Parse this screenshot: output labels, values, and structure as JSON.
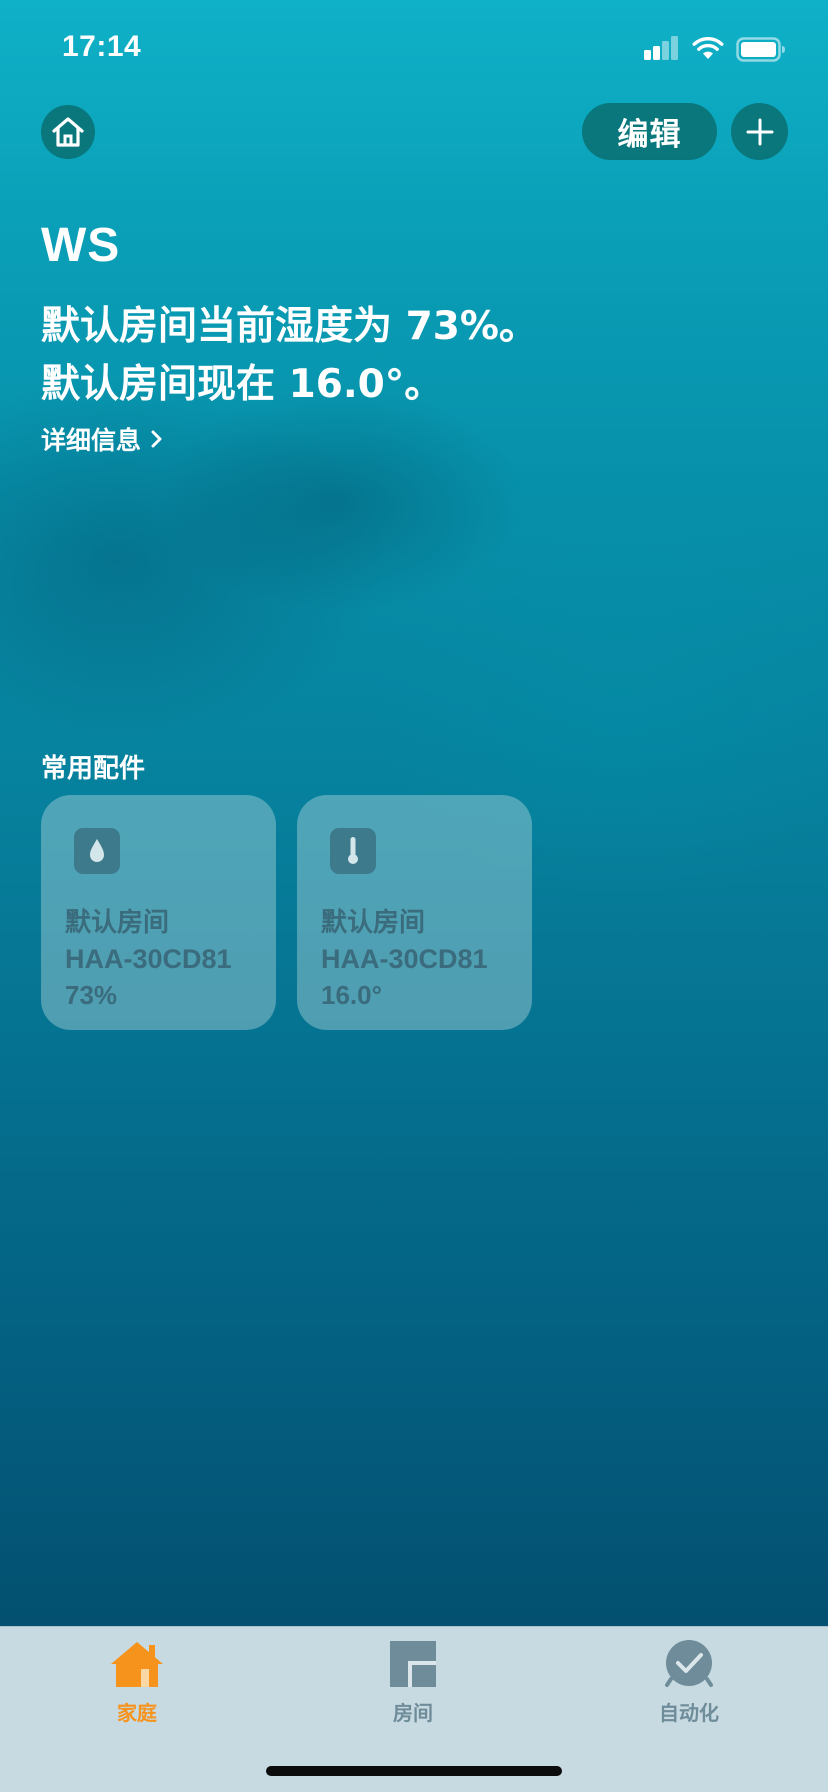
{
  "status_bar": {
    "time": "17:14",
    "signal_icon": "cellular-signal-icon",
    "wifi_icon": "wifi-icon",
    "battery_icon": "battery-icon"
  },
  "header": {
    "home_icon": "house-icon",
    "edit_label": "编辑",
    "add_icon": "plus-icon"
  },
  "summary": {
    "home_name": "WS",
    "line1": "默认房间当前湿度为 73%。",
    "line2": "默认房间现在 16.0°。",
    "details_label": "详细信息"
  },
  "favorites": {
    "title": "常用配件",
    "tiles": [
      {
        "icon": "humidity-drop-icon",
        "room": "默认房间",
        "device": "HAA-30CD81",
        "value": "73%"
      },
      {
        "icon": "thermometer-icon",
        "room": "默认房间",
        "device": "HAA-30CD81",
        "value": "16.0°"
      }
    ]
  },
  "tab_bar": {
    "tabs": [
      {
        "icon": "home-tab-icon",
        "label": "家庭",
        "selected": true
      },
      {
        "icon": "rooms-tab-icon",
        "label": "房间",
        "selected": false
      },
      {
        "icon": "automation-tab-icon",
        "label": "自动化",
        "selected": false
      }
    ]
  },
  "colors": {
    "accent": "#f6931d",
    "tile_text": "#3a6c7d",
    "button_bg": "#096e70"
  }
}
